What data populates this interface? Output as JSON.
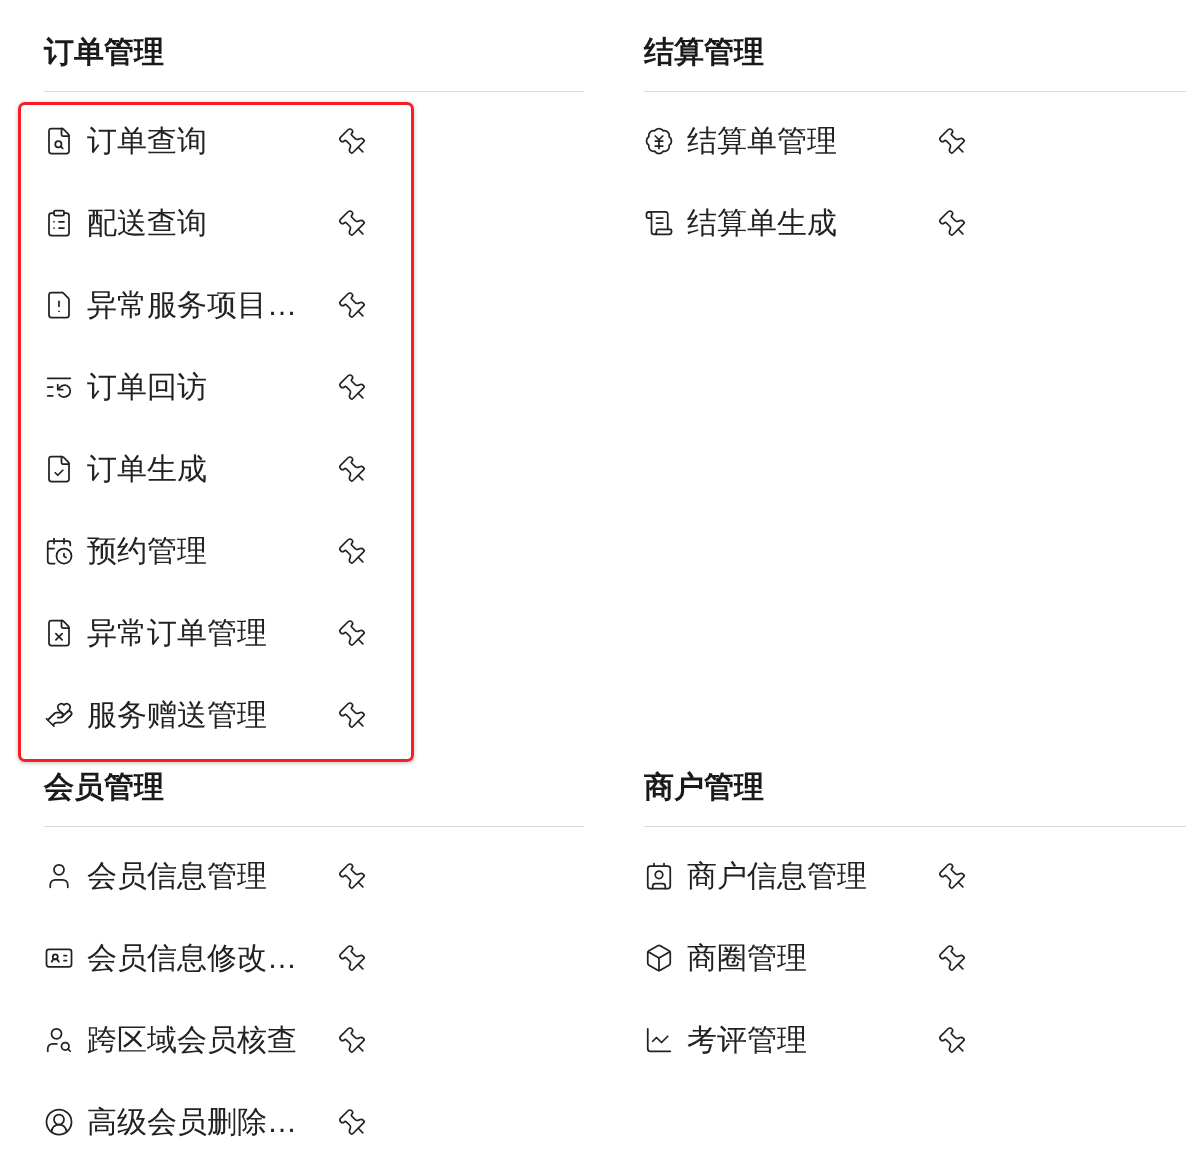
{
  "sections": [
    {
      "title": "订单管理",
      "highlighted": true,
      "items": [
        {
          "label": "订单查询"
        },
        {
          "label": "配送查询"
        },
        {
          "label": "异常服务项目…"
        },
        {
          "label": "订单回访"
        },
        {
          "label": "订单生成"
        },
        {
          "label": "预约管理"
        },
        {
          "label": "异常订单管理"
        },
        {
          "label": "服务赠送管理"
        }
      ]
    },
    {
      "title": "结算管理",
      "highlighted": false,
      "items": [
        {
          "label": "结算单管理"
        },
        {
          "label": "结算单生成"
        }
      ]
    },
    {
      "title": "会员管理",
      "highlighted": false,
      "items": [
        {
          "label": "会员信息管理"
        },
        {
          "label": "会员信息修改…"
        },
        {
          "label": "跨区域会员核查"
        },
        {
          "label": "高级会员删除…"
        }
      ]
    },
    {
      "title": "商户管理",
      "highlighted": false,
      "items": [
        {
          "label": "商户信息管理"
        },
        {
          "label": "商圈管理"
        },
        {
          "label": "考评管理"
        }
      ]
    }
  ]
}
